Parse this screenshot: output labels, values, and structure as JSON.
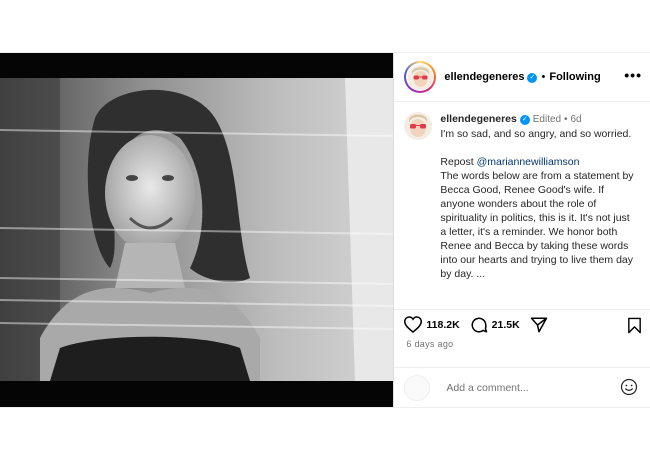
{
  "header": {
    "username": "ellendegeneres",
    "separator": "•",
    "follow_status": "Following",
    "more_icon": "more-horizontal-icon"
  },
  "caption": {
    "username": "ellendegeneres",
    "edited": "Edited",
    "separator": "•",
    "time": "6d",
    "line1": "I'm so sad, and so angry, and so worried.",
    "repost_label": "Repost",
    "repost_handle": "@mariannewilliamson",
    "body": "The words below are from a statement by Becca Good, Renee Good's wife. If anyone wonders about the role of spirituality in politics, this is it. It's not just a letter, it's a reminder. We honor both Renee and Becca by taking these words into our hearts and trying to live them day by day. ..."
  },
  "actions": {
    "likes": "118.2K",
    "comments": "21.5K",
    "icons": [
      "heart-icon",
      "comment-icon",
      "share-icon",
      "bookmark-icon"
    ]
  },
  "post_age": "6 days ago",
  "comment_box": {
    "placeholder": "Add a comment...",
    "emoji_icon": "emoji-icon"
  },
  "colors": {
    "verified": "#0095f6",
    "link": "#00376b",
    "muted": "#737373"
  }
}
